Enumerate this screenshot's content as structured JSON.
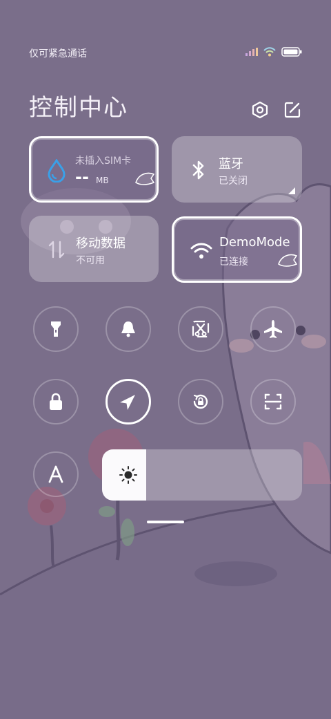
{
  "status_bar": {
    "carrier_text": "仅可紧急通话",
    "signal_icon": "signal-bars-icon",
    "wifi_icon": "wifi-icon",
    "battery_icon": "battery-icon"
  },
  "header": {
    "title": "控制中心",
    "settings_icon": "gear-hexagon-icon",
    "edit_icon": "edit-icon"
  },
  "tiles": {
    "data_usage": {
      "sim_text": "未插入SIM卡",
      "value": "--",
      "unit": "MB",
      "icon": "water-drop-icon"
    },
    "bluetooth": {
      "label": "蓝牙",
      "status": "已关闭",
      "icon": "bluetooth-icon"
    },
    "mobile_data": {
      "label": "移动数据",
      "status": "不可用",
      "icon": "data-arrows-icon"
    },
    "wifi": {
      "label": "DemoMode",
      "status": "已连接",
      "icon": "wifi-icon"
    }
  },
  "toggles": [
    {
      "name": "flashlight",
      "icon": "flashlight-icon",
      "active": false
    },
    {
      "name": "mute",
      "icon": "bell-icon",
      "active": false
    },
    {
      "name": "screenshot",
      "icon": "scissors-icon",
      "active": false
    },
    {
      "name": "airplane",
      "icon": "airplane-icon",
      "active": false
    },
    {
      "name": "lock",
      "icon": "lock-icon",
      "active": false
    },
    {
      "name": "location",
      "icon": "navigation-arrow-icon",
      "active": true
    },
    {
      "name": "rotation-lock",
      "icon": "rotation-lock-icon",
      "active": false
    },
    {
      "name": "scan",
      "icon": "scan-frame-icon",
      "active": false
    },
    {
      "name": "font-size",
      "icon": "letter-a-icon",
      "active": false
    }
  ],
  "brightness": {
    "level": 0.22,
    "icon": "sun-icon"
  },
  "colors": {
    "background": "#7a6e8a",
    "tile": "rgba(255,255,255,0.28)",
    "blue_accent": "#3aa0e8"
  }
}
